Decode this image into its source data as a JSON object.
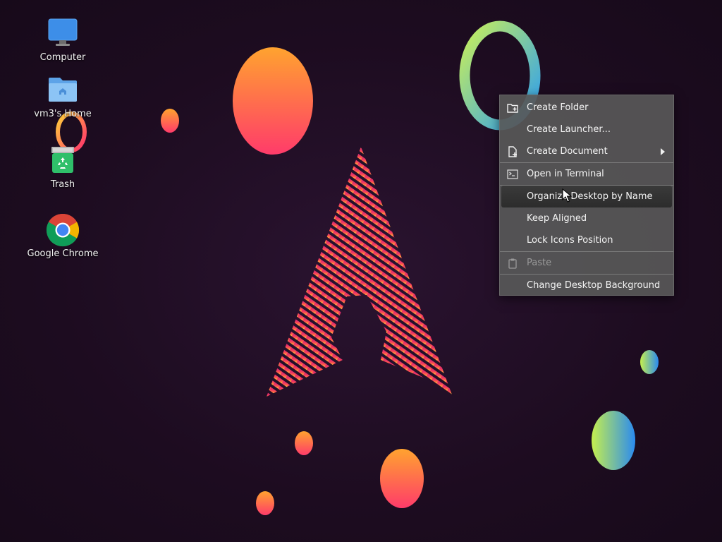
{
  "desktop_icons": [
    {
      "label": "Computer",
      "icon": "monitor-icon"
    },
    {
      "label": "vm3's Home",
      "icon": "home-folder-icon"
    },
    {
      "label": "Trash",
      "icon": "trash-icon"
    },
    {
      "label": "Google Chrome",
      "icon": "chrome-icon"
    }
  ],
  "context_menu": {
    "items": [
      {
        "label": "Create Folder",
        "icon": "folder-plus-icon"
      },
      {
        "label": "Create Launcher..."
      },
      {
        "label": "Create Document",
        "icon": "document-plus-icon",
        "submenu": true
      },
      {
        "label": "Open in Terminal",
        "icon": "terminal-icon"
      },
      {
        "label": "Organize Desktop by Name",
        "state": "hover"
      },
      {
        "label": "Keep Aligned"
      },
      {
        "label": "Lock Icons Position"
      },
      {
        "label": "Paste",
        "icon": "clipboard-icon",
        "state": "disabled"
      },
      {
        "label": "Change Desktop Background"
      }
    ]
  },
  "colors": {
    "menu_bg": "#585858",
    "menu_hover": "#303030",
    "desktop_bg": "#1e0e22",
    "arch_logo": "#e2336b"
  }
}
